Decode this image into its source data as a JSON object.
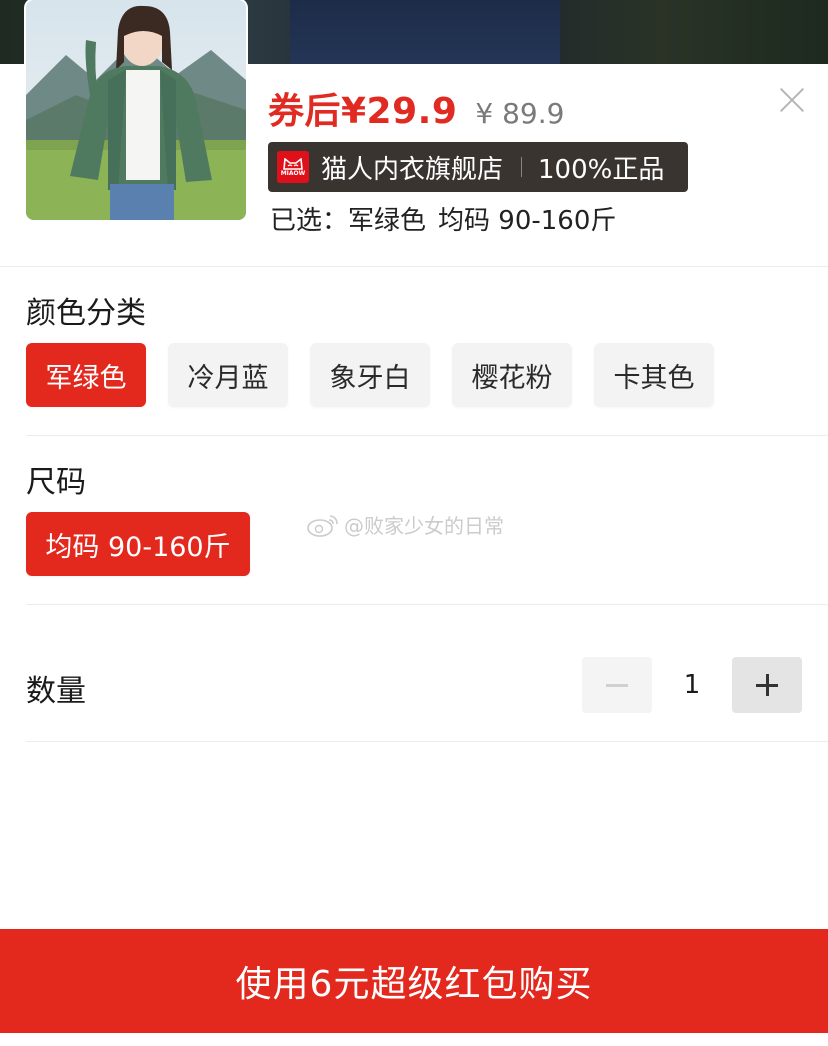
{
  "product": {
    "price_after_coupon": "券后¥29.9",
    "original_price": "¥ 89.9",
    "store": {
      "logo_text": "MIAOW",
      "name": "猫人内衣旗舰店",
      "tag": "100%正品"
    },
    "selected_prefix": "已选：",
    "selected_color": "军绿色",
    "selected_size": "均码 90-160斤"
  },
  "color_section": {
    "title": "颜色分类",
    "options": [
      {
        "label": "军绿色",
        "active": true
      },
      {
        "label": "冷月蓝",
        "active": false
      },
      {
        "label": "象牙白",
        "active": false
      },
      {
        "label": "樱花粉",
        "active": false
      },
      {
        "label": "卡其色",
        "active": false
      }
    ]
  },
  "size_section": {
    "title": "尺码",
    "options": [
      {
        "label": "均码 90-160斤",
        "active": true
      }
    ]
  },
  "watermark": "@败家少女的日常",
  "quantity": {
    "label": "数量",
    "value": "1"
  },
  "buy_button": "使用6元超级红包购买",
  "icons": {
    "close": "close-icon",
    "minus": "minus-icon",
    "plus": "plus-icon",
    "store_logo": "cat-logo-icon",
    "watermark": "weibo-icon"
  },
  "colors": {
    "accent": "#e3281e",
    "price": "#e02a22",
    "store_badge_bg": "#3a3430"
  }
}
